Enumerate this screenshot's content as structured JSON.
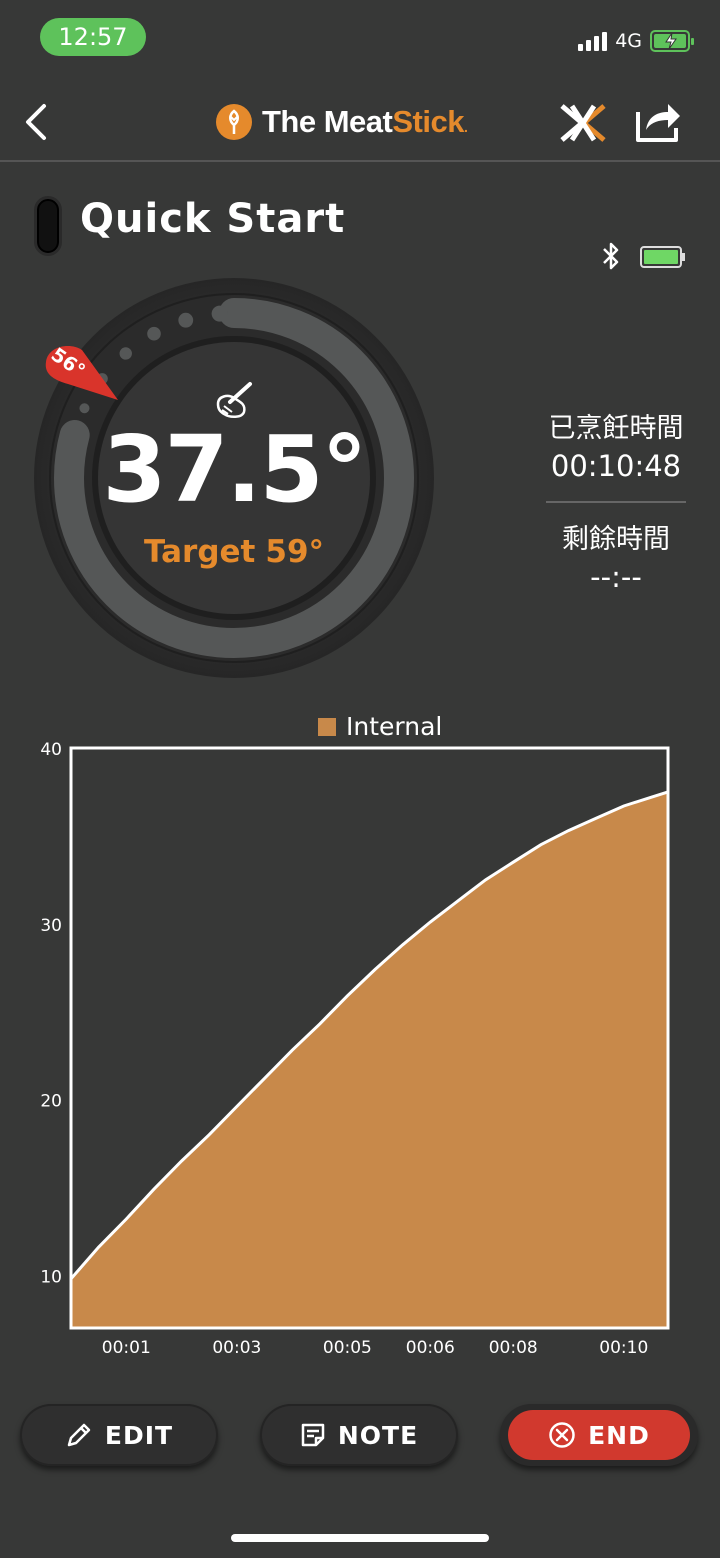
{
  "status_bar": {
    "time": "12:57",
    "network": "4G"
  },
  "nav": {
    "brand_part1": "The Meat",
    "brand_part2": "Stick",
    "brand_reg": "."
  },
  "cook": {
    "title": "Quick Start",
    "current_temp": "37.5°",
    "target_label": "Target",
    "target_temp": "59°",
    "ambient_marker": "56°",
    "gauge_progress": 0.64,
    "elapsed_label": "已烹飪時間",
    "elapsed_value": "00:10:48",
    "remaining_label": "剩餘時間",
    "remaining_value": "--:--"
  },
  "colors": {
    "accent": "#e58a2c",
    "fill": "#c8894a",
    "end": "#d1392e",
    "bg": "#373837"
  },
  "chart_data": {
    "type": "area",
    "legend": [
      "Internal"
    ],
    "series": [
      {
        "name": "Internal",
        "x": [
          0,
          0.5,
          1,
          1.5,
          2,
          2.5,
          3,
          3.5,
          4,
          4.5,
          5,
          5.5,
          6,
          6.5,
          7,
          7.5,
          8,
          8.5,
          9,
          9.5,
          10,
          10.5,
          10.8
        ],
        "values": [
          9.8,
          11.6,
          13.2,
          14.9,
          16.5,
          18.0,
          19.6,
          21.2,
          22.8,
          24.3,
          25.9,
          27.4,
          28.8,
          30.1,
          31.3,
          32.5,
          33.5,
          34.5,
          35.3,
          36.0,
          36.7,
          37.2,
          37.5
        ]
      }
    ],
    "x_ticks": [
      "00:01",
      "00:03",
      "00:05",
      "00:06",
      "00:08",
      "00:10"
    ],
    "x_tick_pos": [
      1,
      3,
      5,
      6.5,
      8,
      10
    ],
    "y_ticks": [
      10,
      20,
      30,
      40
    ],
    "ylim": [
      7,
      40
    ],
    "xlim": [
      0,
      10.8
    ]
  },
  "buttons": {
    "edit": "EDIT",
    "note": "NOTE",
    "end": "END"
  }
}
